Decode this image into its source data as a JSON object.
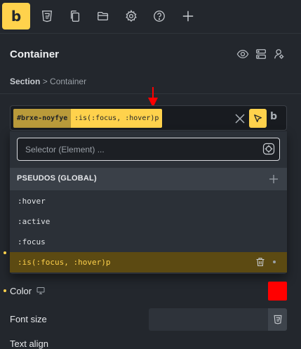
{
  "toolbar": {
    "logo": "b",
    "icons": [
      "css3-icon",
      "copy-icon",
      "folder-icon",
      "gear-icon",
      "help-icon",
      "plus-icon"
    ]
  },
  "header": {
    "title": "Container",
    "icons": [
      "eye-icon",
      "layout-icon",
      "user-settings-icon"
    ]
  },
  "breadcrumb": {
    "parent": "Section",
    "separator": ">",
    "current": "Container"
  },
  "selector": {
    "id_chip": "#brxe-noyfye",
    "pseudo_chip": ":is(:focus, :hover)p",
    "mode_badge": "b"
  },
  "dropdown": {
    "input_placeholder": "Selector (Element) ...",
    "group_label": "PSEUDOS (GLOBAL)",
    "items": [
      ":hover",
      ":active",
      ":focus",
      ":is(:focus, :hover)p"
    ],
    "active_index": 3
  },
  "properties": {
    "color_label": "Color",
    "color_value": "#ff0000",
    "font_size_label": "Font size",
    "text_align_label": "Text align"
  },
  "colors": {
    "accent": "#ffd24c",
    "background": "#23272d",
    "annotation_arrow": "#ff0000"
  }
}
